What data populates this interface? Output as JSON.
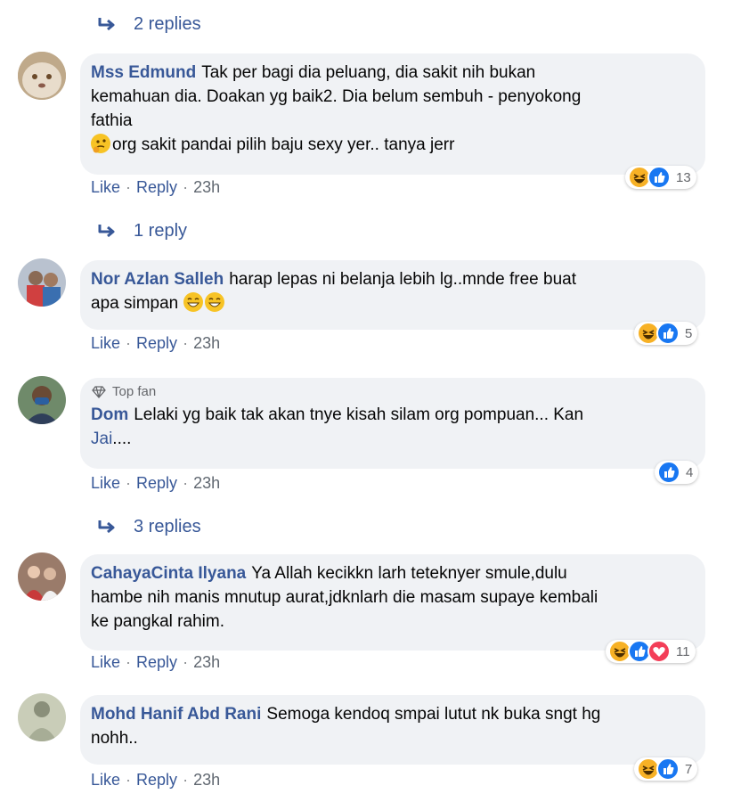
{
  "thread": {
    "replies_1": "2 replies",
    "replies_2": "1 reply",
    "replies_3": "3 replies"
  },
  "comments": [
    {
      "name": "Mss Edmund",
      "text_line1": "Tak per bagi dia peluang, dia sakit nih bukan",
      "text_line2": "kemahuan dia. Doakan yg baik2. Dia belum sembuh - penyokong",
      "text_line3": "fathia",
      "text_line4": "org sakit pandai pilih baju sexy yer.. tanya jerr",
      "like": "Like",
      "reply": "Reply",
      "time": "23h",
      "reaction_count": "13"
    },
    {
      "name": "Nor Azlan Salleh",
      "text_line1": "harap lepas ni belanja lebih lg..mnde free buat",
      "text_line2": "apa simpan",
      "like": "Like",
      "reply": "Reply",
      "time": "23h",
      "reaction_count": "5"
    },
    {
      "badge": "Top fan",
      "name": "Dom",
      "text_line1": "Lelaki yg baik tak akan tnye kisah silam org pompuan... Kan",
      "text_line2_link": "Jai",
      "text_line2_rest": "....",
      "like": "Like",
      "reply": "Reply",
      "time": "23h",
      "reaction_count": "4"
    },
    {
      "name": "CahayaCinta Ilyana",
      "text_line1": "Ya Allah kecikkn larh teteknyer smule,dulu",
      "text_line2": "hambe nih manis mnutup aurat,jdknlarh die masam supaye kembali",
      "text_line3": "ke pangkal rahim.",
      "like": "Like",
      "reply": "Reply",
      "time": "23h",
      "reaction_count": "11"
    },
    {
      "name": "Mohd Hanif Abd Rani",
      "text_line1": "Semoga kendoq smpai lutut nk buka sngt hg",
      "text_line2": "nohh..",
      "like": "Like",
      "reply": "Reply",
      "time": "23h",
      "reaction_count": "7"
    }
  ],
  "dot": "·"
}
